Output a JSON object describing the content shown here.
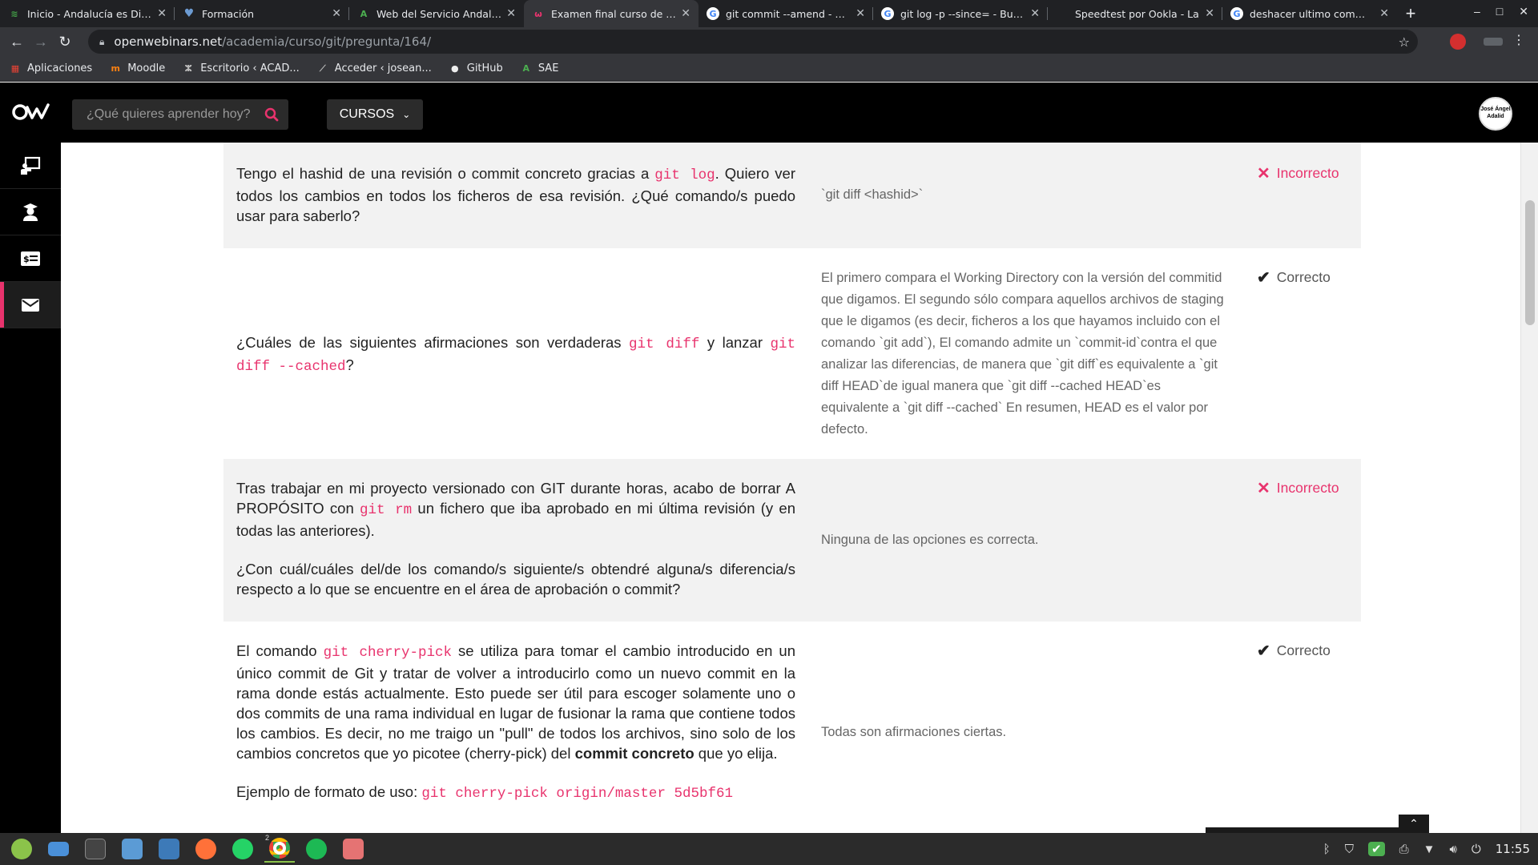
{
  "browser": {
    "tabs": [
      {
        "title": "Inicio - Andalucía es Digital",
        "favicon_color": "#2e7d32",
        "active": false
      },
      {
        "title": "Formación",
        "favicon_color": "#6c9bd2",
        "active": false
      },
      {
        "title": "Web del Servicio Andaluz",
        "favicon_color": "#2e7d32",
        "active": false
      },
      {
        "title": "Examen final curso de Git",
        "favicon_color": "#e8336d",
        "active": true
      },
      {
        "title": "git commit --amend - Busc",
        "favicon_color": "#ffffff",
        "active": false
      },
      {
        "title": "git log -p --since= - Buscar",
        "favicon_color": "#ffffff",
        "active": false
      },
      {
        "title": "Speedtest por Ookla - La",
        "favicon_color": "#202124",
        "active": false
      },
      {
        "title": "deshacer ultimo commit -",
        "favicon_color": "#ffffff",
        "active": false
      }
    ],
    "new_tab_label": "+",
    "url_host": "openwebinars.net",
    "url_path": "/academia/curso/git/pregunta/164/",
    "bookmarks": [
      {
        "label": "Aplicaciones",
        "icon": "apps-grid-icon"
      },
      {
        "label": "Moodle",
        "icon": "moodle-icon"
      },
      {
        "label": "Escritorio ‹ ACAD...",
        "icon": "wordpress-icon"
      },
      {
        "label": "Acceder ‹ josean...",
        "icon": "lamp-icon"
      },
      {
        "label": "GitHub",
        "icon": "github-icon"
      },
      {
        "label": "SAE",
        "icon": "sae-icon"
      }
    ]
  },
  "site": {
    "search_placeholder": "¿Qué quieres aprender hoy?",
    "courses_label": "CURSOS",
    "avatar_text": "José Ángel Adalid",
    "accent": "#e8336d"
  },
  "sidebar": {
    "items": [
      {
        "icon": "presentation-icon",
        "active": false
      },
      {
        "icon": "graduate-icon",
        "active": false
      },
      {
        "icon": "billing-icon",
        "active": false
      },
      {
        "icon": "mail-icon",
        "active": true
      }
    ]
  },
  "questions": [
    {
      "q_parts": [
        "Tengo el hashid de una revisión o commit concreto gracias a ",
        "git log",
        ". Quiero ver todos los cambios en todos los ficheros de esa revisión. ¿Qué comando/s puedo usar para saberlo?"
      ],
      "answer": "`git diff <hashid>`",
      "result": "Incorrecto",
      "correct": false
    },
    {
      "q_parts": [
        "¿Cuáles de las siguientes afirmaciones son verdaderas ",
        "git diff",
        " y lanzar ",
        "git diff --cached",
        "?"
      ],
      "answer": "El primero compara el Working Directory con la versión del commitid que digamos. El segundo sólo compara aquellos archivos de staging que le digamos (es decir, ficheros a los que hayamos incluido con el comando `git add`), El comando admite un `commit-id`contra el que analizar las diferencias, de manera que `git diff`es equivalente a `git diff HEAD`de igual manera que `git diff --cached HEAD`es equivalente a `git diff --cached` En resumen, HEAD es el valor por defecto.",
      "result": "Correcto",
      "correct": true
    },
    {
      "q_parts": [
        "Tras trabajar en mi proyecto versionado con GIT durante horas, acabo de borrar A PROPÓSITO con ",
        "git rm",
        " un fichero que iba aprobado en mi última revisión (y en todas las anteriores)."
      ],
      "q_extra": "¿Con cuál/cuáles del/de los comando/s siguiente/s obtendré alguna/s diferencia/s respecto a lo que se encuentre en el área de aprobación o commit?",
      "answer": "Ninguna de las opciones es correcta.",
      "result": "Incorrecto",
      "correct": false
    },
    {
      "q_parts": [
        "El comando ",
        "git cherry-pick",
        " se utiliza para tomar el cambio introducido en un único commit de Git y tratar de volver a introducirlo como un nuevo commit en la rama donde estás actualmente. Esto puede ser útil para escoger solamente uno o dos commits de una rama individual en lugar de fusionar la rama que contiene todos los cambios. Es decir, no me traigo un \"pull\" de todos los archivos, sino solo de los cambios concretos que yo picotee (cherry-pick) del ",
        "commit concreto",
        " que yo elija."
      ],
      "q_example_label": "Ejemplo de formato de uso: ",
      "q_example_code": "git cherry-pick origin/master 5d5bf61",
      "answer": "Todas son afirmaciones ciertas.",
      "result": "Correcto",
      "correct": true
    }
  ],
  "taskbar": {
    "clock": "11:55",
    "chrome_badge": "2"
  }
}
